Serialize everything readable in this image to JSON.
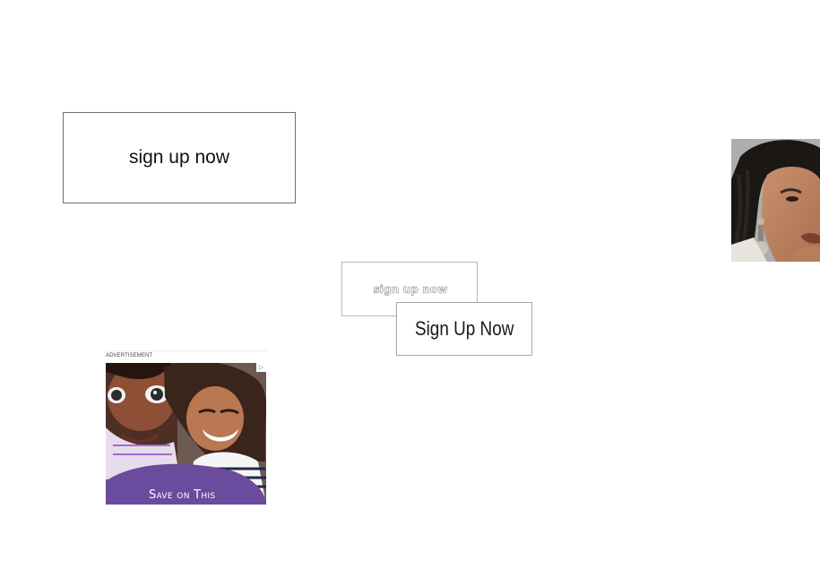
{
  "buttons": {
    "large_label": "sign up now",
    "outline_label": "sign up now",
    "condensed_label": "Sign Up Now"
  },
  "advertisement": {
    "label": "ADVERTISEMENT",
    "choices_icon": "adchoices-icon",
    "cta_text": "Save on This"
  },
  "colors": {
    "ad_purple": "#6a4b9d",
    "ad_choices_blue": "#19a3d7"
  }
}
